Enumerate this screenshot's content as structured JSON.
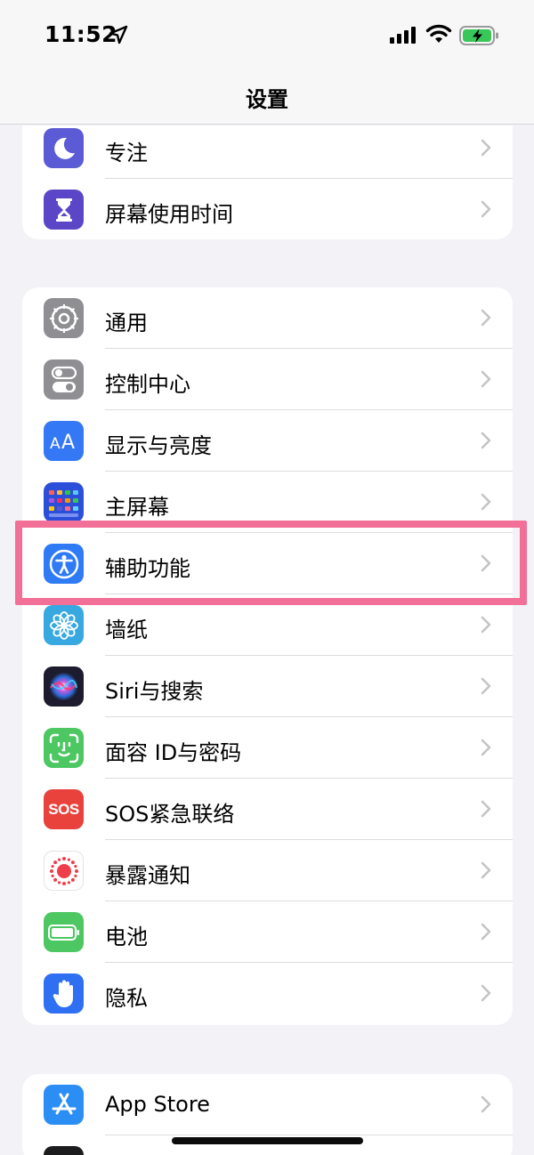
{
  "status": {
    "time": "11:52"
  },
  "nav": {
    "title": "设置"
  },
  "groups": [
    {
      "items": [
        {
          "label": "专注",
          "icon": "moon-icon",
          "color": "#5b5bd6"
        },
        {
          "label": "屏幕使用时间",
          "icon": "hourglass-icon",
          "color": "#5b46c8"
        }
      ]
    },
    {
      "items": [
        {
          "label": "通用",
          "icon": "gear-icon",
          "color": "#8e8e93"
        },
        {
          "label": "控制中心",
          "icon": "toggles-icon",
          "color": "#8e8e93"
        },
        {
          "label": "显示与亮度",
          "icon": "text-size-icon",
          "color": "#3478f6"
        },
        {
          "label": "主屏幕",
          "icon": "home-grid-icon",
          "color": "#2c4fd9"
        },
        {
          "label": "辅助功能",
          "icon": "accessibility-icon",
          "color": "#2f7bf5"
        },
        {
          "label": "墙纸",
          "icon": "flower-icon",
          "color": "#38a8e0"
        },
        {
          "label": "Siri与搜索",
          "icon": "siri-icon",
          "color": "#1c1c2e"
        },
        {
          "label": "面容 ID与密码",
          "icon": "face-id-icon",
          "color": "#4cc761"
        },
        {
          "label": "SOS紧急联络",
          "icon": "sos-icon",
          "color": "#e9423c"
        },
        {
          "label": "暴露通知",
          "icon": "exposure-icon",
          "color": "#ffffff"
        },
        {
          "label": "电池",
          "icon": "battery-icon",
          "color": "#4cc761"
        },
        {
          "label": "隐私",
          "icon": "hand-icon",
          "color": "#2f6ff2"
        }
      ]
    },
    {
      "items": [
        {
          "label": "App Store",
          "icon": "app-store-icon",
          "color": "#2b8ef5"
        },
        {
          "label": "",
          "icon": "wallet-icon",
          "color": "#1c1c1e"
        }
      ]
    }
  ],
  "sos_text": "SOS"
}
